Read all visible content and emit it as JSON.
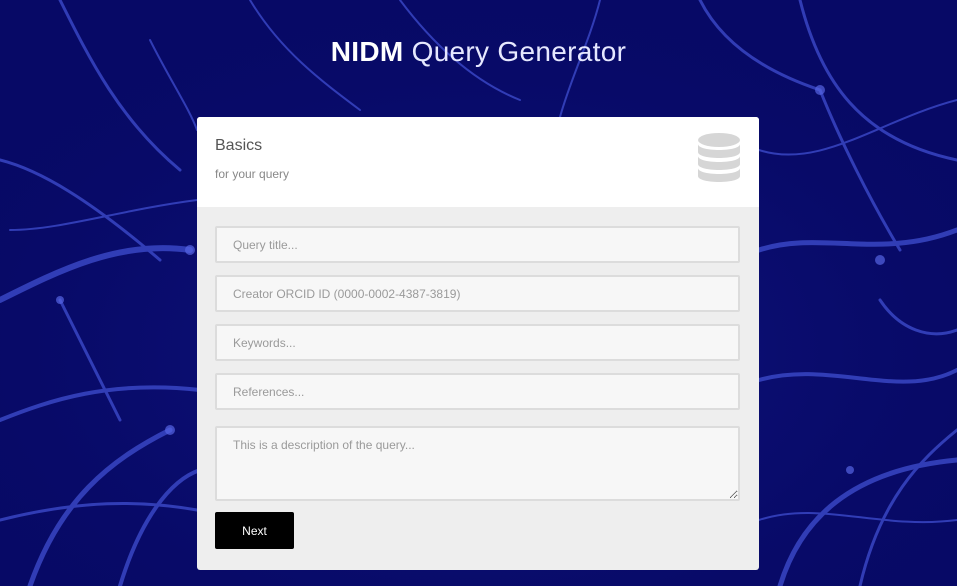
{
  "header": {
    "title_strong": "NIDM",
    "title_light": "Query Generator"
  },
  "card": {
    "title": "Basics",
    "subtitle": "for your query",
    "icon": "database-icon",
    "fields": {
      "query_title": {
        "placeholder": "Query title..."
      },
      "creator_orcid": {
        "placeholder": "Creator ORCID ID (0000-0002-4387-3819)"
      },
      "keywords": {
        "placeholder": "Keywords..."
      },
      "references": {
        "placeholder": "References..."
      },
      "description": {
        "placeholder": "This is a description of the query..."
      }
    },
    "next_label": "Next"
  },
  "colors": {
    "background": "#080a6a",
    "network_lines": "#4a58d8",
    "card_header": "#ffffff",
    "card_body": "#eeeeee",
    "button": "#000000",
    "icon": "#d6d6d6"
  }
}
